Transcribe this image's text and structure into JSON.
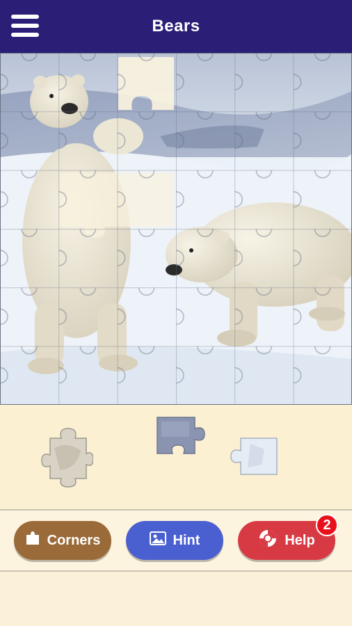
{
  "app": {
    "title": "Bears",
    "menu_icon": "hamburger-menu-icon"
  },
  "board": {
    "grid_columns": 6,
    "grid_rows": 6,
    "image_subject": "two polar bears on snow and ice"
  },
  "tray": {
    "pieces_remaining": 3
  },
  "buttons": {
    "corners": {
      "label": "Corners",
      "icon": "corner-piece-icon",
      "color": "#9a6a38"
    },
    "hint": {
      "label": "Hint",
      "icon": "image-icon",
      "color": "#4a5fd0"
    },
    "help": {
      "label": "Help",
      "icon": "lifebuoy-icon",
      "color": "#d83a44",
      "badge": "2"
    }
  },
  "colors": {
    "topbar": "#2a1e77",
    "background": "#fbf1d8",
    "badge": "#e8101a"
  }
}
